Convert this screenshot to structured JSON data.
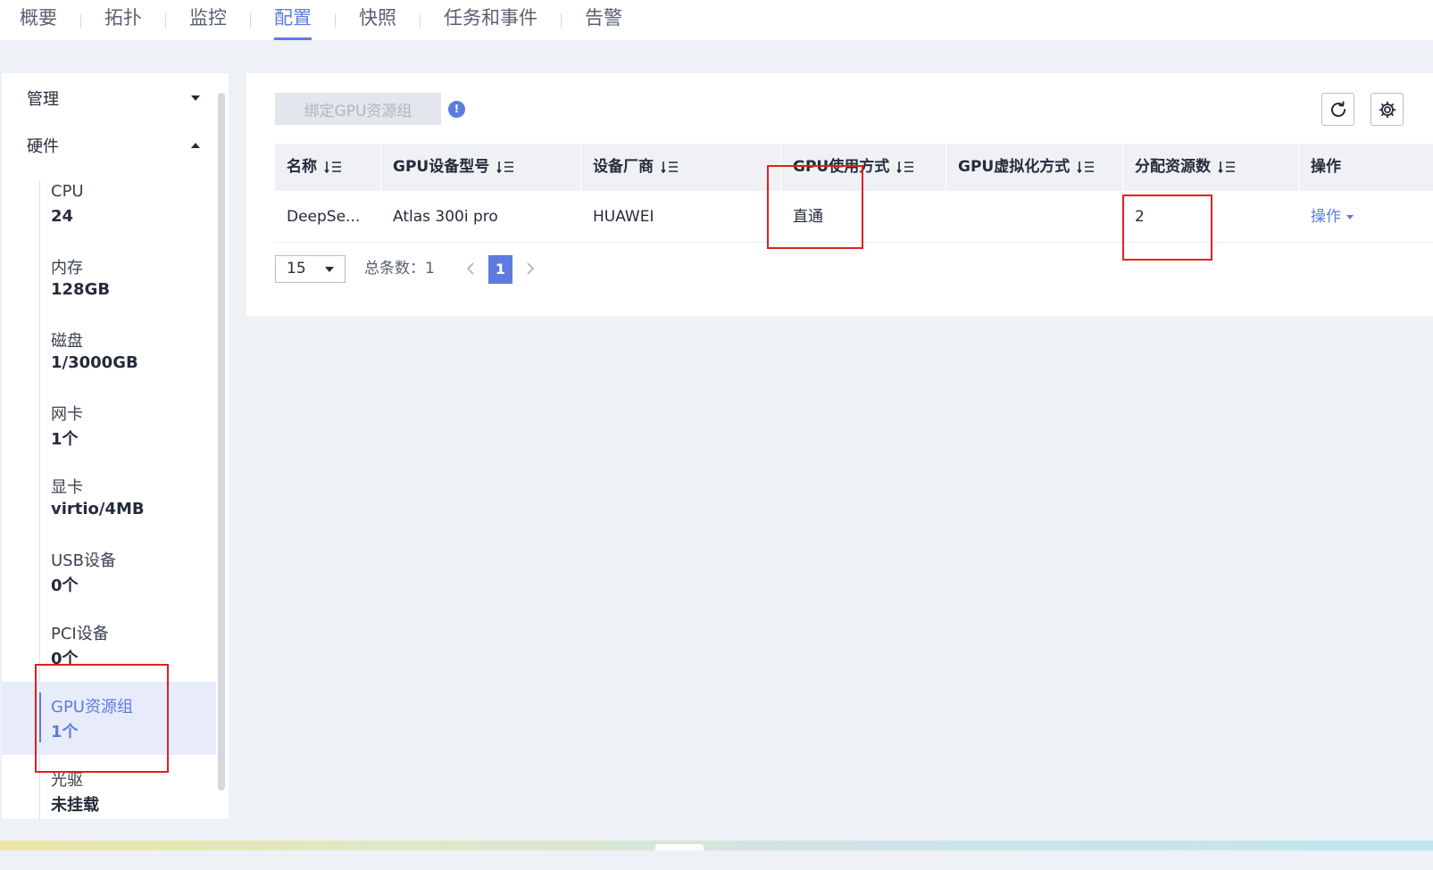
{
  "tabs": [
    {
      "label": "概要"
    },
    {
      "label": "拓扑"
    },
    {
      "label": "监控"
    },
    {
      "label": "配置"
    },
    {
      "label": "快照"
    },
    {
      "label": "任务和事件"
    },
    {
      "label": "告警"
    }
  ],
  "active_tab": "配置",
  "sidebar": {
    "groups": [
      {
        "label": "管理",
        "expanded": false
      },
      {
        "label": "硬件",
        "expanded": true
      }
    ],
    "items": [
      {
        "label": "CPU",
        "value": "24"
      },
      {
        "label": "内存",
        "value": "128GB"
      },
      {
        "label": "磁盘",
        "value": "1/3000GB"
      },
      {
        "label": "网卡",
        "value": "1个"
      },
      {
        "label": "显卡",
        "value": "virtio/4MB"
      },
      {
        "label": "USB设备",
        "value": "0个"
      },
      {
        "label": "PCI设备",
        "value": "0个"
      },
      {
        "label": "GPU资源组",
        "value": "1个",
        "selected": true
      },
      {
        "label": "光驱",
        "value": "未挂载"
      }
    ]
  },
  "toolbar": {
    "bind_label": "绑定GPU资源组",
    "info_glyph": "!"
  },
  "table": {
    "columns": [
      "名称",
      "GPU设备型号",
      "设备厂商",
      "GPU使用方式",
      "GPU虚拟化方式",
      "分配资源数",
      "操作"
    ],
    "rows": [
      {
        "name": "DeepSe...",
        "model": "Atlas 300i pro",
        "vendor": "HUAWEI",
        "usage": "直通",
        "virt": "",
        "alloc": "2",
        "action": "操作"
      }
    ]
  },
  "pagination": {
    "page_size": "15",
    "total_label": "总条数：1",
    "current_page": "1"
  },
  "colors": {
    "accent": "#5e7ce0",
    "highlight": "#e02020"
  }
}
